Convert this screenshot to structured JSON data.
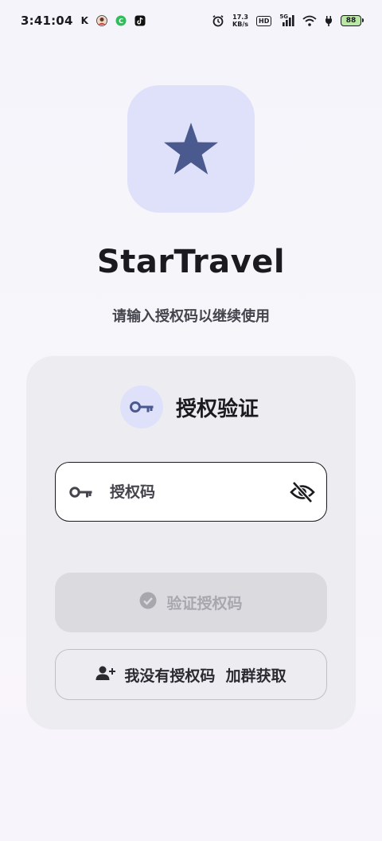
{
  "status_bar": {
    "time": "3:41:04",
    "carrier_letter": "K",
    "net_speed_value": "17.3",
    "net_speed_unit": "KB/s",
    "hd_label": "HD",
    "network_label": "5G",
    "battery_level": "88",
    "icons": [
      "avatar-notification-icon",
      "green-app-icon",
      "tiktok-icon",
      "alarm-icon",
      "signal-icon",
      "wifi-icon",
      "charging-icon",
      "battery-icon"
    ]
  },
  "app": {
    "logo_icon": "star-icon",
    "title": "StarTravel",
    "subtitle": "请输入授权码以继续使用"
  },
  "auth_card": {
    "header_icon": "key-icon",
    "title": "授权验证",
    "code_field": {
      "value": "",
      "placeholder": "授权码",
      "leading_icon": "key-icon",
      "trailing_icon": "eye-off-icon"
    },
    "verify_button": {
      "label": "验证授权码",
      "icon": "check-circle-icon",
      "enabled": false
    },
    "join_group_button": {
      "label": "我没有授权码  加群获取",
      "icon": "person-add-icon"
    }
  },
  "colors": {
    "accent": "#4a5a8f",
    "accent_container": "#dfe1fa",
    "card_bg": "#ededf1",
    "disabled_button_bg": "#dadadf",
    "disabled_text": "#a7a7ad",
    "battery_fill": "#b9e8a6"
  }
}
